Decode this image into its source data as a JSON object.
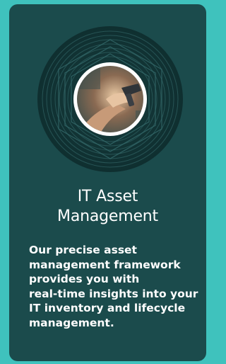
{
  "card": {
    "title_lines": [
      "IT Asset",
      "Management"
    ],
    "description_lines": [
      "Our precise asset",
      "management framework",
      "provides you with",
      "real-time insights into your",
      "IT inventory and lifecycle",
      "management."
    ]
  },
  "colors": {
    "page_background": "#3fc2bd",
    "card_background": "#1b4b4c",
    "text": "#ffffff",
    "accent_ring": "#ffffff"
  },
  "icons": {
    "hero": "person-scanning-barcode-photo"
  }
}
